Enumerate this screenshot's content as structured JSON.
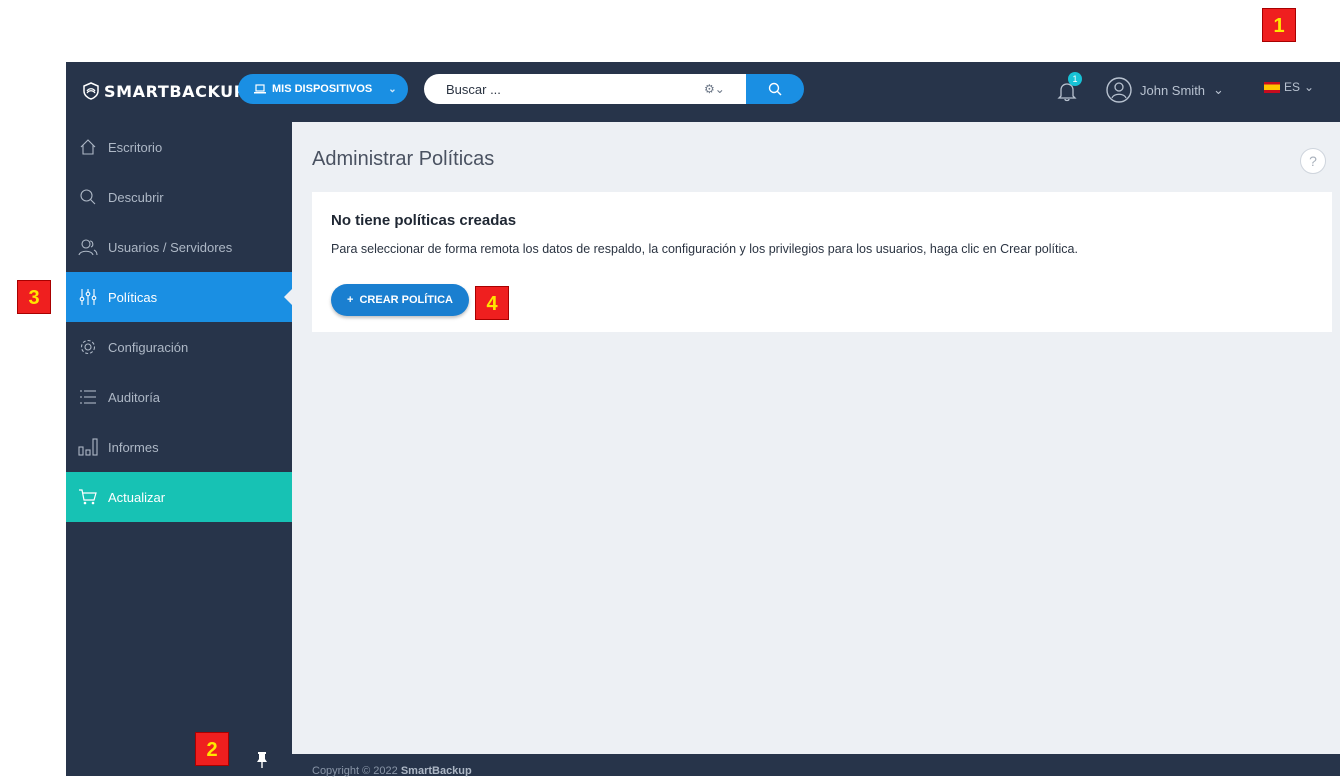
{
  "brand": {
    "name": "SMARTBACKUP"
  },
  "topbar": {
    "devices_label": "MIS DISPOSITIVOS",
    "search_placeholder": "Buscar ...",
    "notifications_count": "1",
    "user_name": "John Smith",
    "language": "ES"
  },
  "sidebar": {
    "items": [
      {
        "label": "Escritorio",
        "icon": "home-icon"
      },
      {
        "label": "Descubrir",
        "icon": "search-icon"
      },
      {
        "label": "Usuarios / Servidores",
        "icon": "users-icon"
      },
      {
        "label": "Políticas",
        "icon": "sliders-icon",
        "active": true
      },
      {
        "label": "Configuración",
        "icon": "gear-icon"
      },
      {
        "label": "Auditoría",
        "icon": "list-icon"
      },
      {
        "label": "Informes",
        "icon": "bar-chart-icon"
      },
      {
        "label": "Actualizar",
        "icon": "cart-icon"
      }
    ]
  },
  "main": {
    "title": "Administrar Políticas",
    "empty_title": "No tiene políticas creadas",
    "empty_text": "Para seleccionar de forma remota los datos de respaldo, la configuración y los privilegios para los usuarios, haga clic en Crear política.",
    "create_button": "CREAR POLÍTICA"
  },
  "footer": {
    "prefix": "Copyright © 2022",
    "brand": "SmartBackup"
  },
  "markers": [
    "1",
    "2",
    "3",
    "4"
  ],
  "colors": {
    "topbar": "#27344a",
    "accent": "#1a8fe3",
    "upgrade": "#17c2b4",
    "marker": "#ef1f1f"
  }
}
